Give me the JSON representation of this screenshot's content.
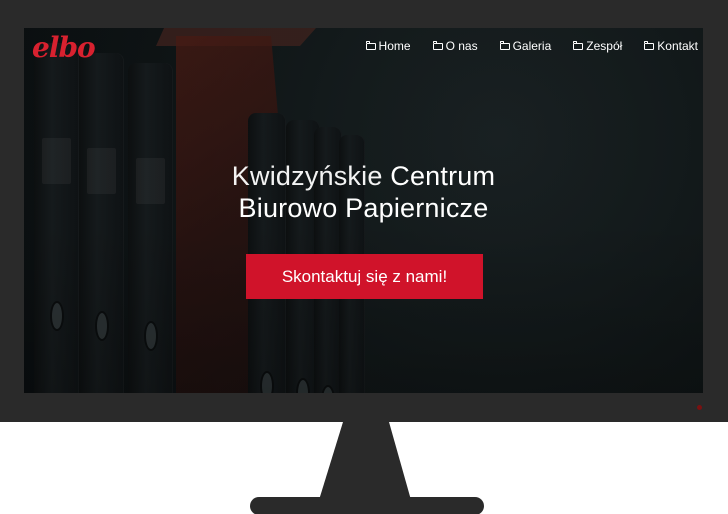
{
  "header": {
    "logo": "elbo"
  },
  "nav": {
    "items": [
      {
        "label": "Home",
        "icon": "folder-icon"
      },
      {
        "label": "O nas",
        "icon": "folder-icon"
      },
      {
        "label": "Galeria",
        "icon": "folder-icon"
      },
      {
        "label": "Zespół",
        "icon": "folder-icon"
      },
      {
        "label": "Kontakt",
        "icon": "folder-icon"
      }
    ]
  },
  "hero": {
    "title_part1": "Kwidzyńskie",
    "title_part2": "Centrum",
    "title_line2": "Biurowo Papiernicze",
    "cta_label": "Skontaktuj się z nami!"
  },
  "colors": {
    "accent": "#d0132a",
    "bezel": "#2a2a2a",
    "screen": "#101617"
  }
}
